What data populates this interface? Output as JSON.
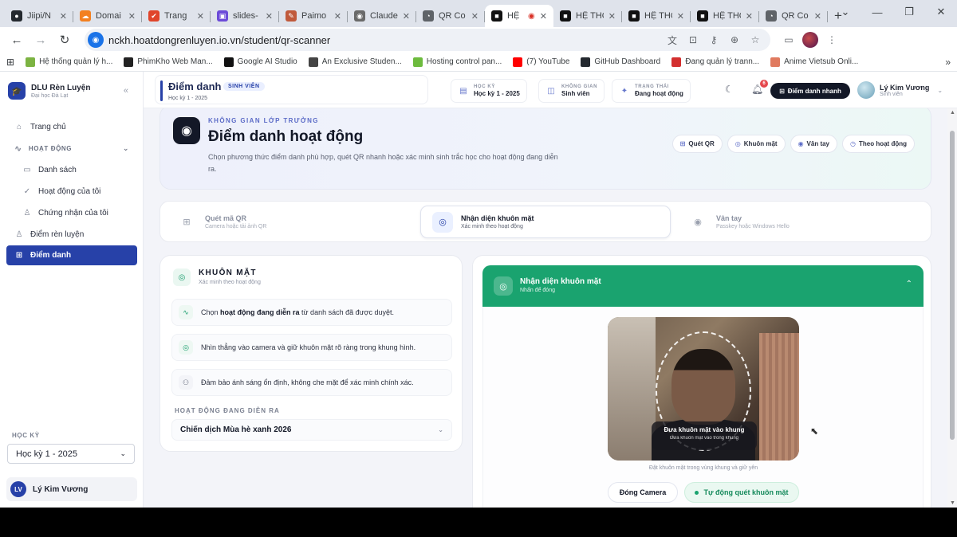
{
  "browser": {
    "tabs": [
      {
        "title": "Jiipi/N",
        "fav_color": "#24292f",
        "fav_glyph": "●"
      },
      {
        "title": "Domai",
        "fav_color": "#f38020",
        "fav_glyph": "☁"
      },
      {
        "title": "Trang",
        "fav_color": "#e0452b",
        "fav_glyph": "✔"
      },
      {
        "title": "slides-",
        "fav_color": "#6c4bd8",
        "fav_glyph": "▣"
      },
      {
        "title": "Paimo",
        "fav_color": "#c05a3c",
        "fav_glyph": "✎"
      },
      {
        "title": "Claude",
        "fav_color": "#6a6a6a",
        "fav_glyph": "◉"
      },
      {
        "title": "QR Co",
        "fav_color": "#5f6368",
        "fav_glyph": "◔"
      },
      {
        "title": "HỆ",
        "fav_color": "#111111",
        "fav_glyph": "■",
        "active": true
      },
      {
        "title": "HỆ THỐ",
        "fav_color": "#111111",
        "fav_glyph": "■"
      },
      {
        "title": "HỆ THỐ",
        "fav_color": "#111111",
        "fav_glyph": "■"
      },
      {
        "title": "HỆ THỐ",
        "fav_color": "#111111",
        "fav_glyph": "■"
      },
      {
        "title": "QR Co",
        "fav_color": "#5f6368",
        "fav_glyph": "◔"
      }
    ],
    "url": "nckh.hoatdongrenluyen.io.vn/student/qr-scanner",
    "bookmarks": [
      {
        "label": "Hệ thống quản lý h...",
        "color": "#7cb342"
      },
      {
        "label": "PhimKho Web Man...",
        "color": "#222222"
      },
      {
        "label": "Google AI Studio",
        "color": "#111111"
      },
      {
        "label": "An Exclusive Studen...",
        "color": "#444444"
      },
      {
        "label": "Hosting control pan...",
        "color": "#6dbb3e"
      },
      {
        "label": "(7) YouTube",
        "color": "#ff0000"
      },
      {
        "label": "GitHub Dashboard",
        "color": "#24292f"
      },
      {
        "label": "Đang quản lý trann...",
        "color": "#d32f2f"
      },
      {
        "label": "Anime Vietsub Onli...",
        "color": "#e07a5f"
      }
    ]
  },
  "sidebar": {
    "brand": "DLU Rèn Luyện",
    "brand_sub": "Đại học Đà Lạt",
    "items": [
      {
        "label": "Trang chủ",
        "icon": "⌂"
      },
      {
        "label": "HOẠT ĐỘNG",
        "icon": "∿"
      },
      {
        "label": "Danh sách",
        "icon": "▭"
      },
      {
        "label": "Hoạt động của tôi",
        "icon": "✓"
      },
      {
        "label": "Chứng nhận của tôi",
        "icon": "♙"
      },
      {
        "label": "Điểm rèn luyện",
        "icon": "♙"
      },
      {
        "label": "Điểm danh",
        "icon": "⊞"
      }
    ],
    "term_label": "HỌC KỲ",
    "term_value": "Học kỳ 1 - 2025",
    "user_initials": "LV",
    "user_name": "Lý Kim Vương"
  },
  "topbar": {
    "title": "Điểm danh",
    "badge": "SINH VIÊN",
    "subtitle": "Học kỳ 1 - 2025",
    "chips": [
      {
        "key": "HỌC KỲ",
        "value": "Học kỳ 1 - 2025",
        "icon": "▤"
      },
      {
        "key": "KHÔNG GIAN",
        "value": "Sinh viên",
        "icon": "◫"
      },
      {
        "key": "TRẠNG THÁI",
        "value": "Đang hoạt động",
        "icon": "✦"
      }
    ],
    "notif_count": "6",
    "quick_label": "Điểm danh nhanh",
    "user_name": "Lý Kim Vương",
    "user_role": "Sinh viên"
  },
  "hero": {
    "kicker": "KHÔNG GIAN LỚP TRƯỞNG",
    "title": "Điểm danh hoạt động",
    "desc": "Chọn phương thức điểm danh phù hợp, quét QR nhanh hoặc xác minh sinh trắc học cho hoạt động đang diễn ra.",
    "tags": [
      {
        "label": "Quét QR",
        "icon": "⊞"
      },
      {
        "label": "Khuôn mặt",
        "icon": "◎"
      },
      {
        "label": "Vân tay",
        "icon": "◉"
      },
      {
        "label": "Theo hoạt động",
        "icon": "◷"
      }
    ]
  },
  "modes": [
    {
      "title": "Quét mã QR",
      "sub": "Camera hoặc tải ảnh QR",
      "icon": "⊞"
    },
    {
      "title": "Nhận diện khuôn mặt",
      "sub": "Xác minh theo hoạt động",
      "icon": "◎",
      "active": true
    },
    {
      "title": "Vân tay",
      "sub": "Passkey hoặc Windows Hello",
      "icon": "◉"
    }
  ],
  "face_panel": {
    "title": "KHUÔN MẶT",
    "sub": "Xác minh theo hoạt động",
    "step1_a": "Chọn ",
    "step1_b": "hoạt động đang diễn ra",
    "step1_c": " từ danh sách đã được duyệt.",
    "step2": "Nhìn thẳng vào camera và giữ khuôn mặt rõ ràng trong khung hình.",
    "step3": "Đảm bảo ánh sáng ổn định, không che mặt để xác minh chính xác.",
    "activity_label": "HOẠT ĐỘNG ĐANG DIỄN RA",
    "activity_value": "Chiến dịch Mùa hè xanh 2026"
  },
  "camera_panel": {
    "title": "Nhận diện khuôn mặt",
    "sub": "Nhấn để đóng",
    "hint_main": "Đưa khuôn mặt vào khung",
    "hint_sub": "Đưa khuôn mặt vào trong khung",
    "note": "Đặt khuôn mặt trong vùng khung và giữ yên",
    "close_btn": "Đóng Camera",
    "auto_btn": "Tự động quét khuôn mặt"
  }
}
